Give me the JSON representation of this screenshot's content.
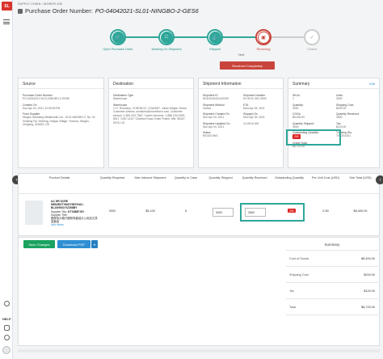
{
  "app": {
    "logo_text": "SL"
  },
  "header": {
    "breadcrumb": "SUPPLY CHAIN / WORKFLOW",
    "title_label": "Purchase Order Number:",
    "title_value": "PO-04042021-SL01-NINGBO-2-GES6"
  },
  "stepper": {
    "steps": [
      {
        "label": "Open Purchase Order",
        "icon": "cart-icon"
      },
      {
        "label": "Working On Shipment",
        "icon": "doc-icon"
      },
      {
        "label": "Shipped",
        "icon": "ship-icon"
      },
      {
        "label": "Receiving",
        "icon": "box-icon"
      },
      {
        "label": "Closed",
        "icon": "check-icon"
      }
    ],
    "next_label": "Next",
    "next_button": "Received Completely"
  },
  "source": {
    "title": "Source",
    "po_label": "Purchase Order Number",
    "po_value": "PO-04042021-SL01-NINGBO-2-GES6",
    "created_label": "Created On",
    "created_value": "Sun Apr 04, 2021 10:09:09 PM",
    "supplier_label": "From Supplier",
    "supplier_value": "Ningbo Jianxiang Metalworks Ltd., SL01-NINGBO-2, No. 51 Xinkeng Rd, Xinkeng, Haiyao Village, Yinzhou, Ningbo, Zhejiang, 315000, CN"
  },
  "destination": {
    "title": "Destination",
    "type_label": "Destination Type",
    "type_value": "Warehouse",
    "wh_label": "Warehouse",
    "wh_value": "C.H. Robinson, CHROB-02, 12340087, Julian Wright, Senior Customer Advisor, solutions@chrobinson.com, Customer service: 1-800-323-7587, Carrier services: 1-888-234-0092, 8017, SOE 14117 Chariton Road, Eden Prairie, MN, 55347-0078, US"
  },
  "shipment": {
    "title": "Shipment Information",
    "fields": [
      {
        "label": "Shipment ID",
        "value": "SIN21040421142205"
      },
      {
        "label": "Shipment Number",
        "value": "SH-EOC-302-3000"
      },
      {
        "label": "Shipment Method",
        "value": "Ocean"
      },
      {
        "label": "ETA",
        "value": "Mon Apr 05, 2021"
      },
      {
        "label": "Shipment Created On",
        "value": "Sun Apr 04, 2021"
      },
      {
        "label": "Shipped On",
        "value": "Mon Apr 05, 2021"
      },
      {
        "label": "Shipment Updated On",
        "value": "Sun Apr 04, 2021"
      },
      {
        "label": "",
        "value": "12:28:10 AM"
      },
      {
        "label": "Status",
        "value": "RECEIVING"
      }
    ]
  },
  "summary_card": {
    "title": "Summary",
    "edit": "Edit",
    "fields_left": [
      {
        "label": "SKUs:",
        "value": "1"
      },
      {
        "label": "Quantity:",
        "value": "3000"
      },
      {
        "label": "COGs:",
        "value": "$8,400.00"
      },
      {
        "label": "Quantity Shipped:",
        "value": "3000"
      },
      {
        "label": "Outstanding Quantity:",
        "value": "200"
      },
      {
        "label": "Grand Total:",
        "value": "$8,720.00"
      }
    ],
    "fields_right": [
      {
        "label": "Units:",
        "value": "3000"
      },
      {
        "label": "Shipping Cost:",
        "value": "$200.00"
      },
      {
        "label": "Quantity Received:",
        "value": "2800"
      },
      {
        "label": "Tax:",
        "value": "$120.00"
      },
      {
        "label": "Tracking IDs:",
        "value": "TRK001001"
      }
    ]
  },
  "table": {
    "headers": [
      "Product Details",
      "Quantity Required",
      "Max Inbound Shipment",
      "Quantity In Case",
      "Quantity Shipped",
      "Quantity Received",
      "Outstanding Quantity",
      "Per Unit Cost (USD)",
      "Sub Total (USD)"
    ],
    "row": {
      "title": "AC HR SCRE MED/BOTXMOY587G/AC-BL15/9001Y/Z358BY",
      "supplier_sku_label": "Supplier Sku:",
      "supplier_sku": "KT1588F-BY",
      "supplier_title_label": "Supplier Title:",
      "supplier_title": "圆珠笔大箱尺圆珠笔套装办公用品文具盒套装",
      "add_notes": "Add Notes",
      "qty_required": "3000",
      "max_inbound": "$5,100",
      "qty_in_case": "6",
      "qty_shipped": "3000",
      "qty_received": "2800",
      "outstanding": "200",
      "per_unit": "2.80",
      "subtotal": "$8,400.00"
    }
  },
  "actions": {
    "save": "Save Changes",
    "download": "Download PDF"
  },
  "summary_panel": {
    "title": "Summary",
    "rows": [
      {
        "label": "Cost of Goods",
        "value": "$8,400.00"
      },
      {
        "label": "Shipping Cost",
        "value": "$200.00"
      },
      {
        "label": "Tax",
        "value": "$120.00"
      },
      {
        "label": "Total",
        "value": "$8,720.00"
      }
    ]
  },
  "side": {
    "help": "HELP"
  }
}
